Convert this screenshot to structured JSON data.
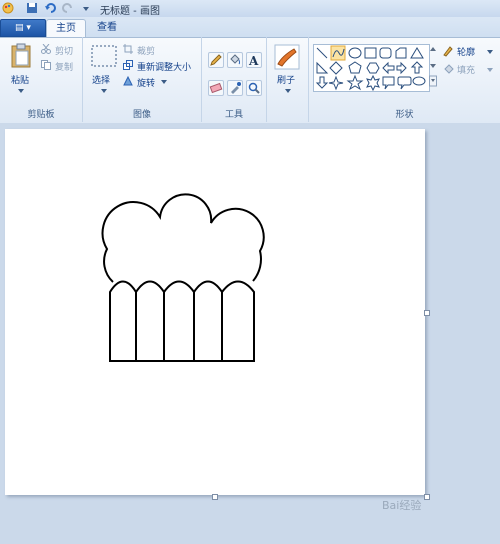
{
  "window": {
    "title": "无标题 - 画图"
  },
  "file_button": {
    "label": "▤ ▾"
  },
  "tabs": [
    {
      "label": "主页",
      "active": true
    },
    {
      "label": "查看",
      "active": false
    }
  ],
  "ribbon": {
    "clipboard": {
      "label": "剪贴板",
      "paste": "粘贴",
      "cut": "剪切",
      "copy": "复制"
    },
    "image": {
      "label": "图像",
      "select": "选择",
      "crop": "裁剪",
      "resize": "重新调整大小",
      "rotate": "旋转"
    },
    "tools": {
      "label": "工具"
    },
    "brushes": {
      "label": "刷子"
    },
    "shapes": {
      "label": "形状",
      "outline": "轮廓",
      "fill": "填充"
    }
  },
  "watermark": {
    "text": "Bai经验"
  },
  "colors": {
    "accent": "#2b62b3",
    "ribbon_bg": "#dfe9f5",
    "canvas": "#ffffff"
  }
}
